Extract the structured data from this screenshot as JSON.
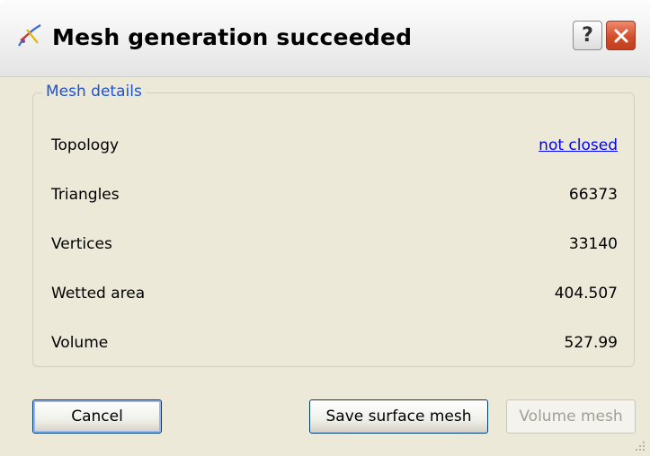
{
  "dialog": {
    "title": "Mesh generation succeeded",
    "help_glyph": "?",
    "icons": {
      "app": "mesh-app-icon",
      "help": "help-icon",
      "close": "close-icon"
    }
  },
  "details": {
    "group_label": "Mesh details",
    "rows": [
      {
        "label": "Topology",
        "value": "not closed"
      },
      {
        "label": "Triangles",
        "value": "66373"
      },
      {
        "label": "Vertices",
        "value": "33140"
      },
      {
        "label": "Wetted area",
        "value": "404.507"
      },
      {
        "label": "Volume",
        "value": "527.99"
      }
    ]
  },
  "buttons": {
    "cancel": "Cancel",
    "save_surface": "Save surface mesh",
    "volume_mesh": "Volume mesh"
  },
  "colors": {
    "group_title": "#1b53d3",
    "link": "#0000ff",
    "dialog_bg": "#ece9d8",
    "close_button": "#d24d2c"
  }
}
